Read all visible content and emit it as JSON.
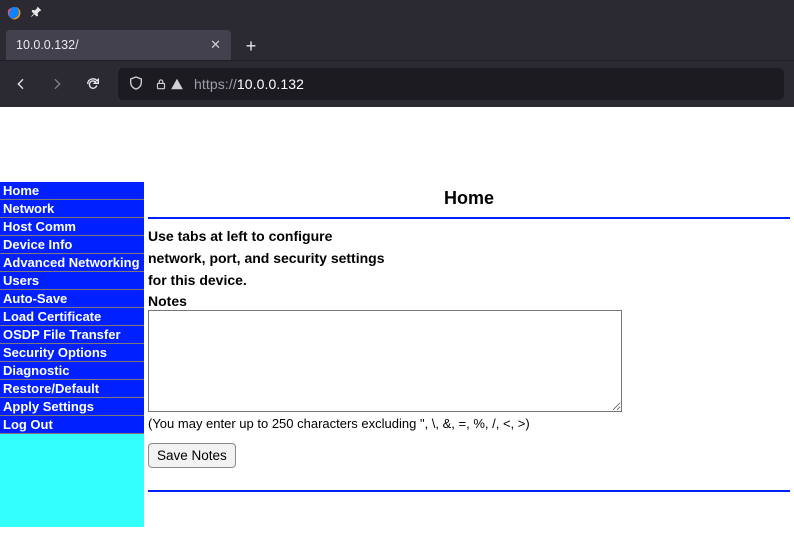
{
  "browser": {
    "tab_title": "10.0.0.132/",
    "url_scheme": "https://",
    "url_host": "10.0.0.132"
  },
  "sidebar": {
    "items": [
      {
        "label": "Home"
      },
      {
        "label": "Network"
      },
      {
        "label": "Host Comm"
      },
      {
        "label": "Device Info"
      },
      {
        "label": "Advanced Networking"
      },
      {
        "label": "Users"
      },
      {
        "label": "Auto-Save"
      },
      {
        "label": "Load Certificate"
      },
      {
        "label": "OSDP File Transfer"
      },
      {
        "label": "Security Options"
      },
      {
        "label": "Diagnostic"
      },
      {
        "label": "Restore/Default"
      },
      {
        "label": "Apply Settings"
      },
      {
        "label": "Log Out"
      }
    ]
  },
  "main": {
    "title": "Home",
    "intro_line1": "Use tabs at left to configure",
    "intro_line2": "network, port, and security settings",
    "intro_line3": "for this device.",
    "notes_label": "Notes",
    "notes_value": "",
    "notes_hint": "(You may enter up to 250 characters excluding \", \\, &, =, %, /, <, >)",
    "save_label": "Save Notes"
  }
}
